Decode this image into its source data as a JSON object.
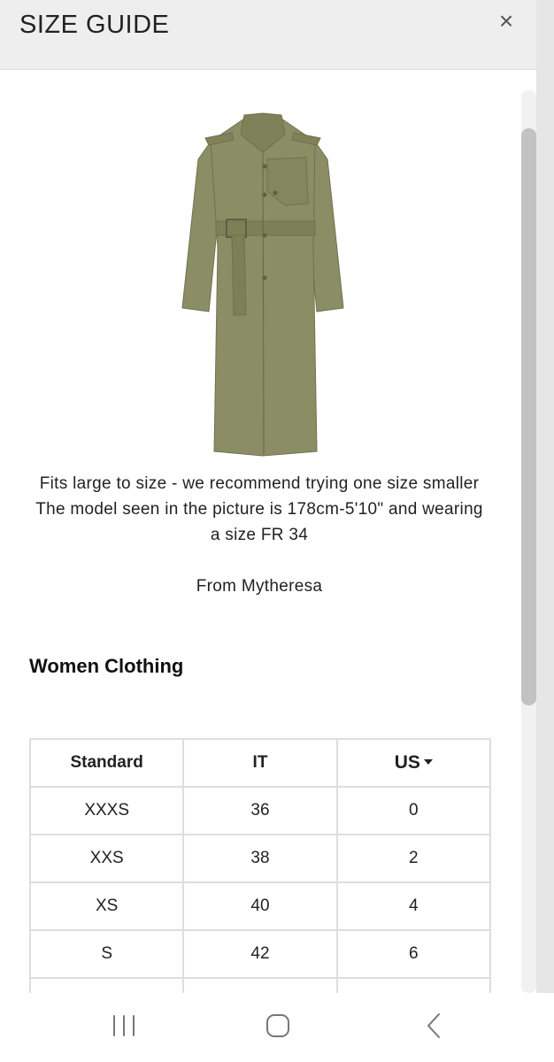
{
  "header": {
    "title": "SIZE GUIDE",
    "close_symbol": "×"
  },
  "product": {
    "image_icon": "trench-coat-image",
    "coat_color": "#8b8d65"
  },
  "fit_note": "Fits large to size - we recommend trying one size smaller The model seen in the picture is 178cm-5'10\" and wearing a size FR 34",
  "source_note": "From Mytheresa",
  "section": {
    "title": "Women Clothing"
  },
  "size_table": {
    "columns": [
      "Standard",
      "IT",
      "US"
    ],
    "rows": [
      [
        "XXXS",
        "36",
        "0"
      ],
      [
        "XXS",
        "38",
        "2"
      ],
      [
        "XS",
        "40",
        "4"
      ],
      [
        "S",
        "42",
        "6"
      ]
    ]
  },
  "nav": {
    "recent_icon": "recent-apps-icon",
    "home_icon": "home-icon",
    "back_icon": "back-icon"
  }
}
